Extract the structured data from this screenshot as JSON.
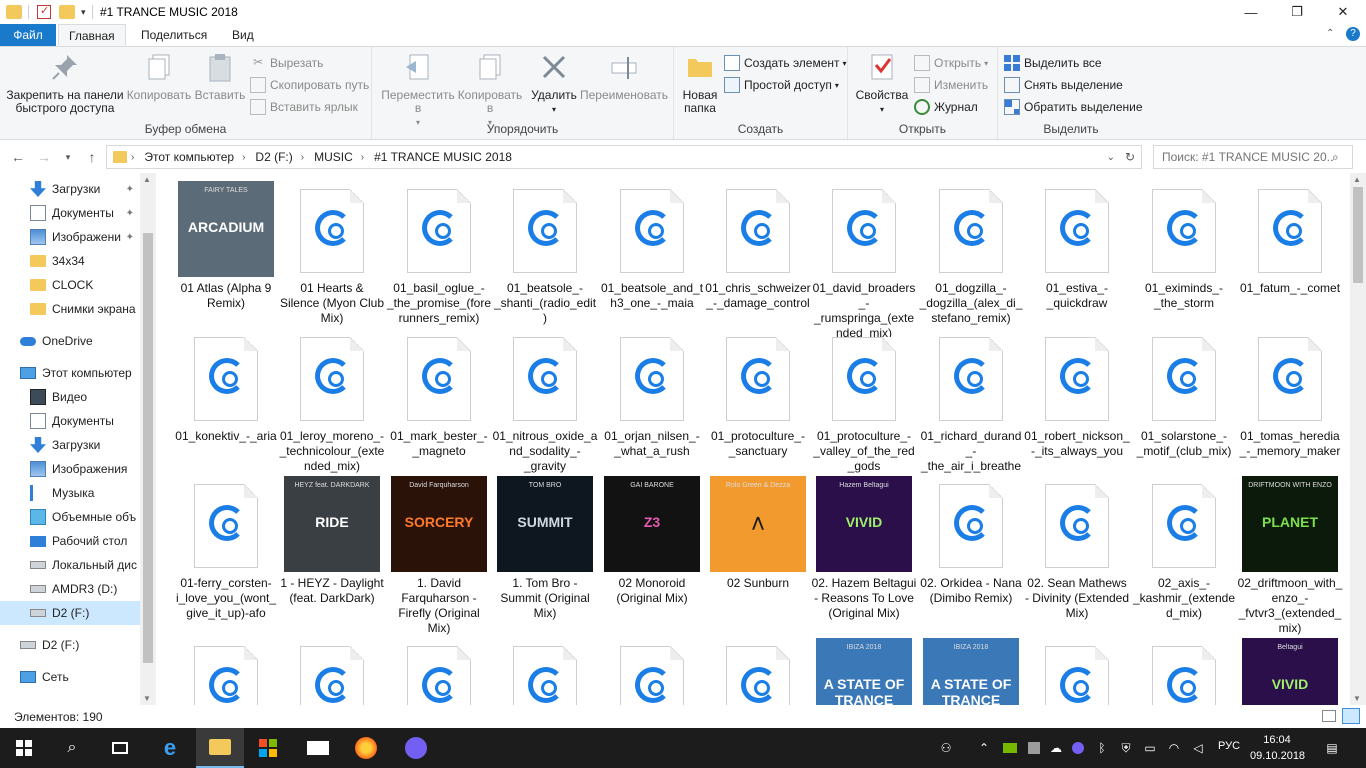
{
  "window": {
    "title": "#1 TRANCE MUSIC 2018",
    "minimize": "—",
    "maximize": "❐",
    "close": "✕"
  },
  "ribbon_tabs": [
    "Файл",
    "Главная",
    "Поделиться",
    "Вид"
  ],
  "ribbon": {
    "clipboard": {
      "label": "Буфер обмена",
      "pin": "Закрепить на панели быстрого доступа",
      "copy": "Копировать",
      "paste": "Вставить",
      "cut": "Вырезать",
      "copy_path": "Скопировать путь",
      "paste_shortcut": "Вставить ярлык"
    },
    "organize": {
      "label": "Упорядочить",
      "move": "Переместить в",
      "copy_to": "Копировать в",
      "delete": "Удалить",
      "rename": "Переименовать"
    },
    "create": {
      "label": "Создать",
      "new_folder": "Новая папка",
      "new_item": "Создать элемент",
      "easy_access": "Простой доступ"
    },
    "open": {
      "label": "Открыть",
      "properties": "Свойства",
      "open": "Открыть",
      "edit": "Изменить",
      "history": "Журнал"
    },
    "select": {
      "label": "Выделить",
      "select_all": "Выделить все",
      "select_none": "Снять выделение",
      "invert": "Обратить выделение"
    }
  },
  "address": {
    "crumbs": [
      "Этот компьютер",
      "D2 (F:)",
      "MUSIC",
      "#1 TRANCE MUSIC 2018"
    ],
    "search_placeholder": "Поиск: #1 TRANCE MUSIC 20..."
  },
  "nav": {
    "items": [
      {
        "label": "Загрузки",
        "icon": "download-icon",
        "pinned": true
      },
      {
        "label": "Документы",
        "icon": "documents-icon",
        "pinned": true
      },
      {
        "label": "Изображени",
        "icon": "pictures-icon",
        "pinned": true
      },
      {
        "label": "34x34",
        "icon": "folder-icon",
        "pinned": false
      },
      {
        "label": "CLOCK",
        "icon": "folder-icon",
        "pinned": false
      },
      {
        "label": "Снимки экрана",
        "icon": "folder-icon",
        "pinned": false
      },
      {
        "label": "OneDrive",
        "icon": "onedrive-icon",
        "pinned": false
      },
      {
        "label": "Этот компьютер",
        "icon": "computer-icon",
        "pinned": false
      },
      {
        "label": "Видео",
        "icon": "video-icon",
        "pinned": false
      },
      {
        "label": "Документы",
        "icon": "documents-icon",
        "pinned": false
      },
      {
        "label": "Загрузки",
        "icon": "download-icon",
        "pinned": false
      },
      {
        "label": "Изображения",
        "icon": "pictures-icon",
        "pinned": false
      },
      {
        "label": "Музыка",
        "icon": "music-icon",
        "pinned": false
      },
      {
        "label": "Объемные объ",
        "icon": "3d-objects-icon",
        "pinned": false
      },
      {
        "label": "Рабочий стол",
        "icon": "desktop-icon",
        "pinned": false
      },
      {
        "label": "Локальный дис",
        "icon": "drive-icon",
        "pinned": false
      },
      {
        "label": "AMDR3 (D:)",
        "icon": "drive-icon",
        "pinned": false
      },
      {
        "label": "D2 (F:)",
        "icon": "drive-icon",
        "pinned": false
      },
      {
        "label": "D2 (F:)",
        "icon": "drive-icon",
        "pinned": false
      },
      {
        "label": "Сеть",
        "icon": "network-icon",
        "pinned": false
      }
    ],
    "pin_glyph": "📌"
  },
  "files": [
    {
      "name": "01 Atlas (Alpha 9 Remix)",
      "type": "cover",
      "cover": {
        "bg": "#5b6b78",
        "text": "ARCADIUM",
        "sub": "FAIRY TALES",
        "color": "#ffffff"
      }
    },
    {
      "name": "01 Hearts & Silence (Myon Club Mix)",
      "type": "audio"
    },
    {
      "name": "01_basil_oglue_-_the_promise_(forerunners_remix)",
      "type": "audio"
    },
    {
      "name": "01_beatsole_-_shanti_(radio_edit)",
      "type": "audio"
    },
    {
      "name": "01_beatsole_and_th3_one_-_maia",
      "type": "audio"
    },
    {
      "name": "01_chris_schweizer_-_damage_control",
      "type": "audio"
    },
    {
      "name": "01_david_broaders_-_rumspringa_(extended_mix)",
      "type": "audio"
    },
    {
      "name": "01_dogzilla_-_dogzilla_(alex_di_stefano_remix)",
      "type": "audio"
    },
    {
      "name": "01_estiva_-_quickdraw",
      "type": "audio"
    },
    {
      "name": "01_eximinds_-_the_storm",
      "type": "audio"
    },
    {
      "name": "01_fatum_-_comet",
      "type": "audio"
    },
    {
      "name": "01_konektiv_-_aria",
      "type": "audio"
    },
    {
      "name": "01_leroy_moreno_-_technicolour_(extended_mix)",
      "type": "audio"
    },
    {
      "name": "01_mark_bester_-_magneto",
      "type": "audio"
    },
    {
      "name": "01_nitrous_oxide_and_sodality_-_gravity",
      "type": "audio"
    },
    {
      "name": "01_orjan_nilsen_-_what_a_rush",
      "type": "audio"
    },
    {
      "name": "01_protoculture_-_sanctuary",
      "type": "audio"
    },
    {
      "name": "01_protoculture_-_valley_of_the_red_gods",
      "type": "audio"
    },
    {
      "name": "01_richard_durand_-_the_air_i_breathe",
      "type": "audio"
    },
    {
      "name": "01_robert_nickson_-_its_always_you",
      "type": "audio"
    },
    {
      "name": "01_solarstone_-_motif_(club_mix)",
      "type": "audio"
    },
    {
      "name": "01_tomas_heredia_-_memory_maker",
      "type": "audio"
    },
    {
      "name": "01-ferry_corsten-i_love_you_(wont_give_it_up)-afo",
      "type": "audio"
    },
    {
      "name": "1 - HEYZ - Daylight (feat. DarkDark)",
      "type": "cover",
      "cover": {
        "bg": "#3a3f44",
        "text": "RIDE",
        "sub": "HEYZ feat. DARKDARK",
        "color": "#ffffff"
      }
    },
    {
      "name": "1. David Farquharson - Firefly (Original Mix)",
      "type": "cover",
      "cover": {
        "bg": "#2a1208",
        "text": "SORCERY",
        "sub": "David Farquharson",
        "color": "#ff7a2a"
      }
    },
    {
      "name": "1. Tom Bro - Summit (Original Mix)",
      "type": "cover",
      "cover": {
        "bg": "#0e1620",
        "text": "SUMMIT",
        "sub": "TOM BRO",
        "color": "#cfd8e0"
      }
    },
    {
      "name": "02 Monoroid (Original Mix)",
      "type": "cover",
      "cover": {
        "bg": "#121212",
        "text": "Z3",
        "sub": "GAI BARONE",
        "color": "#e85ab0"
      }
    },
    {
      "name": "02 Sunburn",
      "type": "cover",
      "cover": {
        "bg": "#f29a2e",
        "text": "⋀",
        "sub": "Rolo Green & Dezza",
        "color": "#1a1a1a"
      }
    },
    {
      "name": "02.  Hazem Beltagui - Reasons To Love (Original Mix)",
      "type": "cover",
      "cover": {
        "bg": "#2a0f4a",
        "text": "VIVID",
        "sub": "Hazem Beltagui",
        "color": "#9ef06a"
      }
    },
    {
      "name": "02. Orkidea - Nana (Dimibo Remix)",
      "type": "audio"
    },
    {
      "name": "02. Sean Mathews - Divinity (Extended Mix)",
      "type": "audio"
    },
    {
      "name": "02_axis_-_kashmir_(extended_mix)",
      "type": "audio"
    },
    {
      "name": "02_driftmoon_with_enzo_-_fvtvr3_(extended_mix)",
      "type": "cover",
      "cover": {
        "bg": "#0c1a0c",
        "text": "PLANET",
        "sub": "DRIFTMOON WITH ENZO",
        "color": "#7be04a"
      }
    },
    {
      "name": "",
      "type": "audio"
    },
    {
      "name": "",
      "type": "audio"
    },
    {
      "name": "",
      "type": "audio"
    },
    {
      "name": "",
      "type": "audio"
    },
    {
      "name": "",
      "type": "audio"
    },
    {
      "name": "",
      "type": "audio"
    },
    {
      "name": "",
      "type": "cover",
      "cover": {
        "bg": "#3a78b8",
        "text": "A STATE OF TRANCE",
        "sub": "IBIZA 2018",
        "color": "#ffffff"
      }
    },
    {
      "name": "",
      "type": "cover",
      "cover": {
        "bg": "#3a78b8",
        "text": "A STATE OF TRANCE",
        "sub": "IBIZA 2018",
        "color": "#ffffff"
      }
    },
    {
      "name": "",
      "type": "audio"
    },
    {
      "name": "",
      "type": "audio"
    },
    {
      "name": "",
      "type": "cover",
      "cover": {
        "bg": "#2a0f4a",
        "text": "VIVID",
        "sub": "Beltagui",
        "color": "#9ef06a"
      }
    }
  ],
  "status": {
    "items": "Элементов: 190"
  },
  "taskbar": {
    "lang": "РУС",
    "time": "16:04",
    "date": "09.10.2018"
  },
  "colors": {
    "accent": "#1979ca",
    "audio_icon": "#1a7ee6",
    "selection": "#cce8ff"
  }
}
